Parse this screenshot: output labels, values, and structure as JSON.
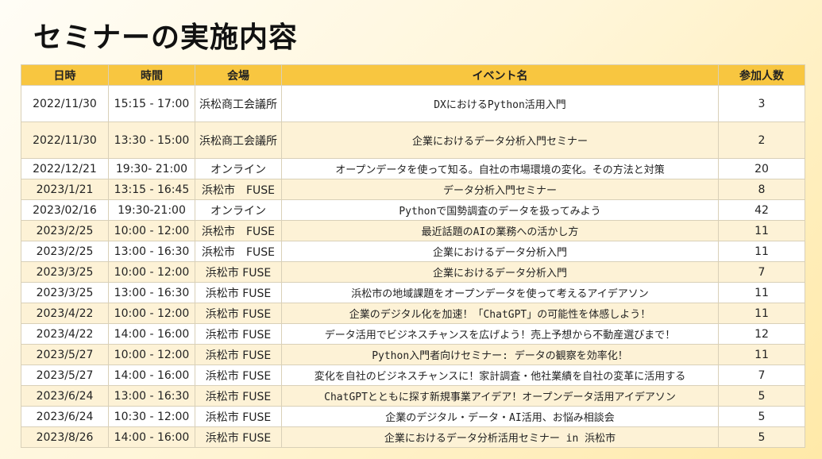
{
  "title": "セミナーの実施内容",
  "table": {
    "headers": [
      "日時",
      "時間",
      "会場",
      "イベント名",
      "参加人数"
    ],
    "rows": [
      [
        "2022/11/30",
        "15:15 - 17:00",
        "浜松商工会議所",
        "DXにおけるPython活用入門",
        "3"
      ],
      [
        "2022/11/30",
        "13:30 - 15:00",
        "浜松商工会議所",
        "企業におけるデータ分析入門セミナー",
        "2"
      ],
      [
        "2022/12/21",
        "19:30- 21:00",
        "オンライン",
        "オープンデータを使って知る。自社の市場環境の変化。その方法と対策",
        "20"
      ],
      [
        "2023/1/21",
        "13:15 - 16:45",
        "浜松市　FUSE",
        "データ分析入門セミナー",
        "8"
      ],
      [
        "2023/02/16",
        "19:30-21:00",
        "オンライン",
        "Pythonで国勢調査のデータを扱ってみよう",
        "42"
      ],
      [
        "2023/2/25",
        "10:00 - 12:00",
        "浜松市　FUSE",
        "最近話題のAIの業務への活かし方",
        "11"
      ],
      [
        "2023/2/25",
        "13:00 - 16:30",
        "浜松市　FUSE",
        "企業におけるデータ分析入門",
        "11"
      ],
      [
        "2023/3/25",
        "10:00 - 12:00",
        "浜松市 FUSE",
        "企業におけるデータ分析入門",
        "7"
      ],
      [
        "2023/3/25",
        "13:00 - 16:30",
        "浜松市 FUSE",
        "浜松市の地域課題をオープンデータを使って考えるアイデアソン",
        "11"
      ],
      [
        "2023/4/22",
        "10:00 - 12:00",
        "浜松市 FUSE",
        "企業のデジタル化を加速！「ChatGPT」の可能性を体感しよう！",
        "11"
      ],
      [
        "2023/4/22",
        "14:00 - 16:00",
        "浜松市 FUSE",
        "データ活用でビジネスチャンスを広げよう！売上予想から不動産選びまで！",
        "12"
      ],
      [
        "2023/5/27",
        "10:00 - 12:00",
        "浜松市 FUSE",
        "Python入門者向けセミナー: データの観察を効率化！",
        "11"
      ],
      [
        "2023/5/27",
        "14:00 - 16:00",
        "浜松市 FUSE",
        "変化を自社のビジネスチャンスに！家計調査・他社業績を自社の変革に活用する",
        "7"
      ],
      [
        "2023/6/24",
        "13:00 - 16:30",
        "浜松市 FUSE",
        "ChatGPTとともに探す新規事業アイデア！オープンデータ活用アイデアソン",
        "5"
      ],
      [
        "2023/6/24",
        "10:30 - 12:00",
        "浜松市 FUSE",
        "企業のデジタル・データ・AI活用、お悩み相談会",
        "5"
      ],
      [
        "2023/8/26",
        "14:00 - 16:00",
        "浜松市 FUSE",
        "企業におけるデータ分析活用セミナー in 浜松市",
        "5"
      ]
    ]
  },
  "colors": {
    "header_bg": "#f8c640",
    "row_alt_bg": "#fdf2d6",
    "row_bg": "#ffffff"
  }
}
